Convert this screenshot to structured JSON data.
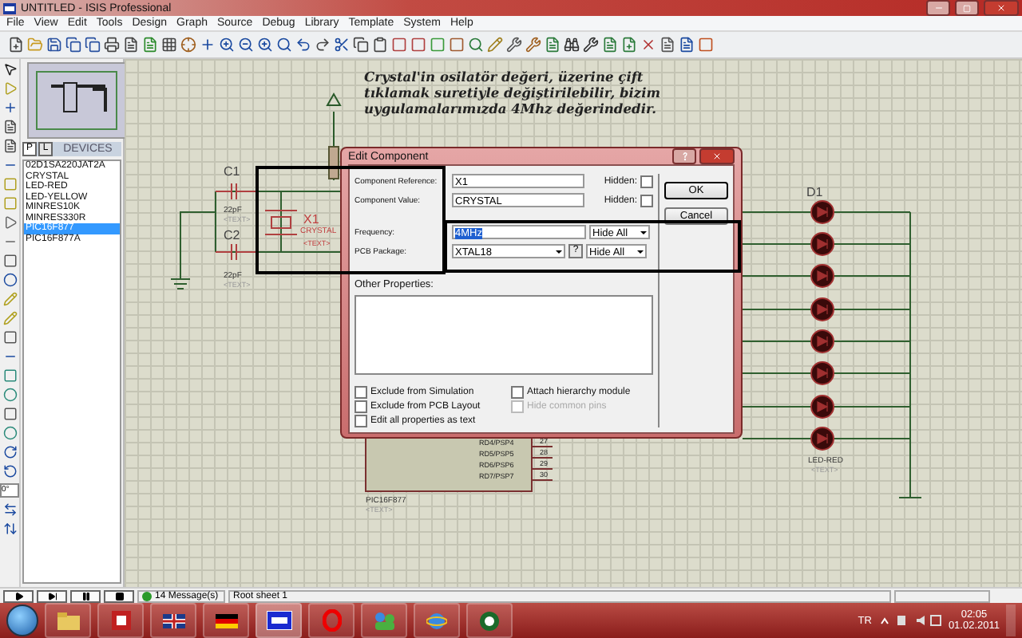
{
  "window": {
    "title": "UNTITLED - ISIS Professional"
  },
  "menu": [
    "File",
    "View",
    "Edit",
    "Tools",
    "Design",
    "Graph",
    "Source",
    "Debug",
    "Library",
    "Template",
    "System",
    "Help"
  ],
  "rotation_field": {
    "value": "0°"
  },
  "sidebar": {
    "tabs": [
      {
        "label": "P",
        "selected": true
      },
      {
        "label": "L",
        "selected": false
      }
    ],
    "header": "DEVICES",
    "devices": [
      {
        "name": "02D1SA220JAT2A",
        "selected": false
      },
      {
        "name": "CRYSTAL",
        "selected": false
      },
      {
        "name": "LED-RED",
        "selected": false
      },
      {
        "name": "LED-YELLOW",
        "selected": false
      },
      {
        "name": "MINRES10K",
        "selected": false
      },
      {
        "name": "MINRES330R",
        "selected": false
      },
      {
        "name": "PIC16F877",
        "selected": true
      },
      {
        "name": "PIC16F877A",
        "selected": false
      }
    ]
  },
  "annotation": [
    "Crystal'in osilatör değeri, üzerine çift",
    "tıklamak suretiyle değiştirilebilir, bizim",
    "uygulamalarımızda 4Mhz değerindedir."
  ],
  "schematic": {
    "c1": {
      "ref": "C1",
      "value": "22pF",
      "text": "<TEXT>"
    },
    "c2": {
      "ref": "C2",
      "value": "22pF",
      "text": "<TEXT>"
    },
    "x1": {
      "ref": "X1",
      "value": "CRYSTAL",
      "text": "<TEXT>"
    },
    "chip": {
      "name": "PIC16F877",
      "text": "<TEXT>",
      "pins": [
        {
          "label": "RD4/PSP4",
          "number": "27"
        },
        {
          "label": "RD5/PSP5",
          "number": "28"
        },
        {
          "label": "RD6/PSP6",
          "number": "29"
        },
        {
          "label": "RD7/PSP7",
          "number": "30"
        }
      ]
    },
    "leds": {
      "ref": "D1",
      "value": "LED-RED",
      "text": "<TEXT>"
    }
  },
  "dialog": {
    "title": "Edit Component",
    "rows": [
      {
        "kind": "text",
        "label": "Component Reference:",
        "value": "X1",
        "hidden_label": "Hidden:",
        "hidden": false
      },
      {
        "kind": "text",
        "label": "Component Value:",
        "value": "CRYSTAL",
        "hidden_label": "Hidden:",
        "hidden": false
      },
      {
        "kind": "property",
        "label": "Frequency:",
        "value": "4MHz",
        "value_selected": true,
        "visibility": "Hide All"
      },
      {
        "kind": "package",
        "label": "PCB Package:",
        "value": "XTAL18",
        "help": "?",
        "visibility": "Hide All"
      }
    ],
    "other_label": "Other Properties:",
    "options": [
      {
        "label": "Exclude from Simulation",
        "checked": false,
        "disabled": false
      },
      {
        "label": "Exclude from PCB Layout",
        "checked": false,
        "disabled": false
      },
      {
        "label": "Edit all properties as text",
        "checked": false,
        "disabled": false
      },
      {
        "label": "Attach hierarchy module",
        "checked": false,
        "disabled": false
      },
      {
        "label": "Hide common pins",
        "checked": false,
        "disabled": true
      }
    ],
    "buttons": [
      "OK",
      "Cancel"
    ]
  },
  "status_bar": {
    "messages": "14 Message(s)",
    "sheet": "Root sheet 1"
  },
  "taskbar": {
    "language": "TR",
    "time": "02:05",
    "date": "01.02.2011"
  }
}
